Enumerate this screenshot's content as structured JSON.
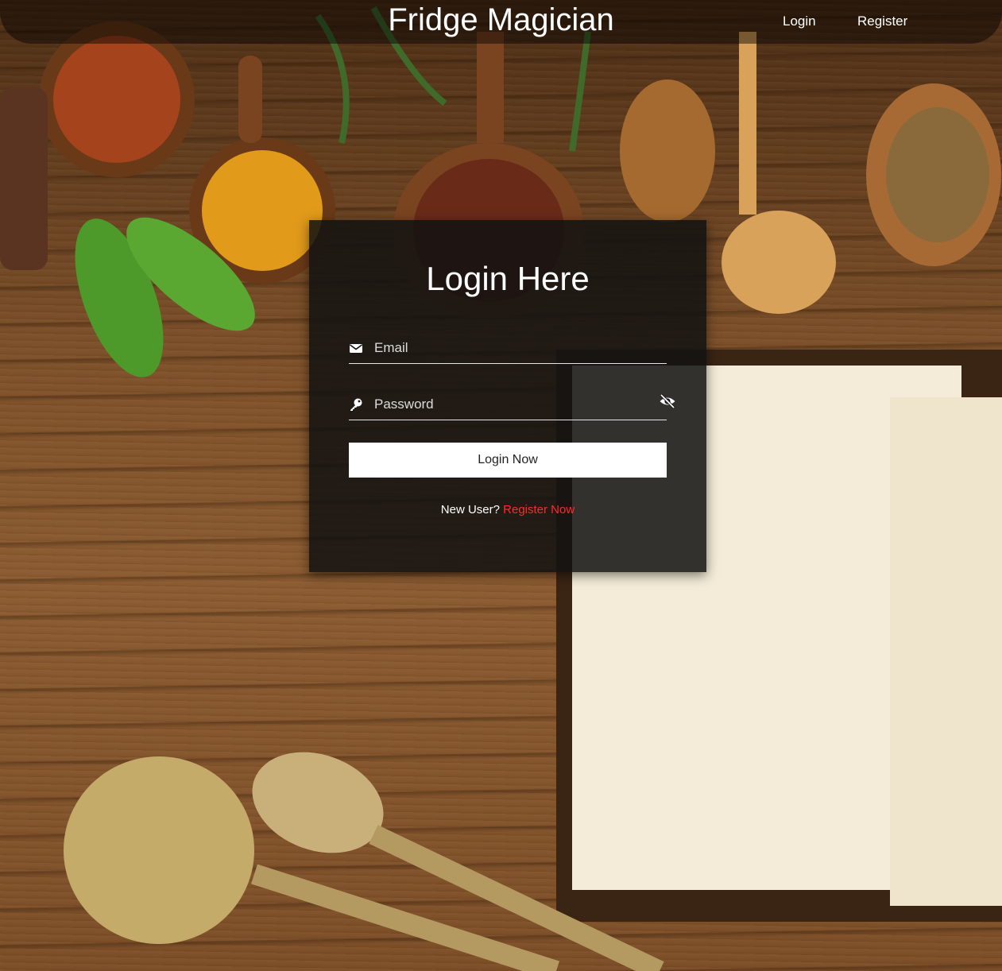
{
  "header": {
    "brand": "Fridge Magician",
    "nav": {
      "login": "Login",
      "register": "Register"
    }
  },
  "login_card": {
    "title": "Login Here",
    "email_placeholder": "Email",
    "password_placeholder": "Password",
    "submit_label": "Login Now",
    "new_user_text": "New User?",
    "register_link": "Register Now"
  },
  "icons": {
    "email": "envelope-icon",
    "password": "key-icon",
    "toggle_password": "eye-slash-icon"
  },
  "colors": {
    "link_accent": "#ff2b2b",
    "card_bg": "#121212",
    "button_bg": "#ffffff"
  }
}
